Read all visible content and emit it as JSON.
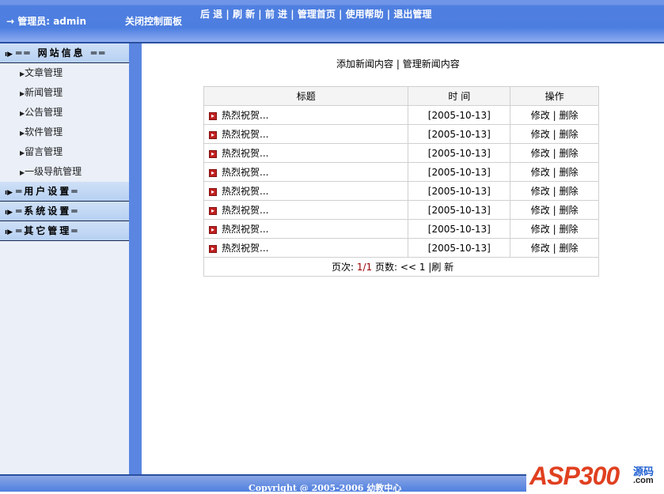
{
  "header": {
    "admin": "→ 管理员: admin",
    "close_panel": "关闭控制面板",
    "nav": [
      "后 退",
      "刷 新",
      "前 进",
      "管理首页",
      "使用帮助",
      "退出管理"
    ]
  },
  "sidebar": {
    "groups": [
      {
        "label": "══ 网站信息 ══",
        "title": "网站信息",
        "items": [
          "文章管理",
          "新闻管理",
          "公告管理",
          "软件管理",
          "留言管理",
          "一级导航管理"
        ]
      },
      {
        "title": "用户设置"
      },
      {
        "title": "系统设置"
      },
      {
        "title": "其它管理"
      }
    ]
  },
  "main": {
    "add_link": "添加新闻内容",
    "manage_link": "管理新闻内容",
    "columns": [
      "标题",
      "时 间",
      "操作"
    ],
    "rows": [
      {
        "title": "热烈祝贺...",
        "date": "[2005-10-13]",
        "edit": "修改",
        "delete": "删除"
      },
      {
        "title": "热烈祝贺...",
        "date": "[2005-10-13]",
        "edit": "修改",
        "delete": "删除"
      },
      {
        "title": "热烈祝贺...",
        "date": "[2005-10-13]",
        "edit": "修改",
        "delete": "删除"
      },
      {
        "title": "热烈祝贺...",
        "date": "[2005-10-13]",
        "edit": "修改",
        "delete": "删除"
      },
      {
        "title": "热烈祝贺...",
        "date": "[2005-10-13]",
        "edit": "修改",
        "delete": "删除"
      },
      {
        "title": "热烈祝贺...",
        "date": "[2005-10-13]",
        "edit": "修改",
        "delete": "删除"
      },
      {
        "title": "热烈祝贺...",
        "date": "[2005-10-13]",
        "edit": "修改",
        "delete": "删除"
      },
      {
        "title": "热烈祝贺...",
        "date": "[2005-10-13]",
        "edit": "修改",
        "delete": "删除"
      }
    ],
    "pager": {
      "page_label": "页次:",
      "page": "1/1",
      "count_label": "页数:",
      "prev": "<<",
      "num": "1",
      "refresh": "|刷 新"
    }
  },
  "footer": {
    "copyright": "Copyright @ 2005-2006 幼教中心"
  },
  "logo": {
    "text": "ASP300",
    "cn": "源码",
    "com": ".com"
  }
}
